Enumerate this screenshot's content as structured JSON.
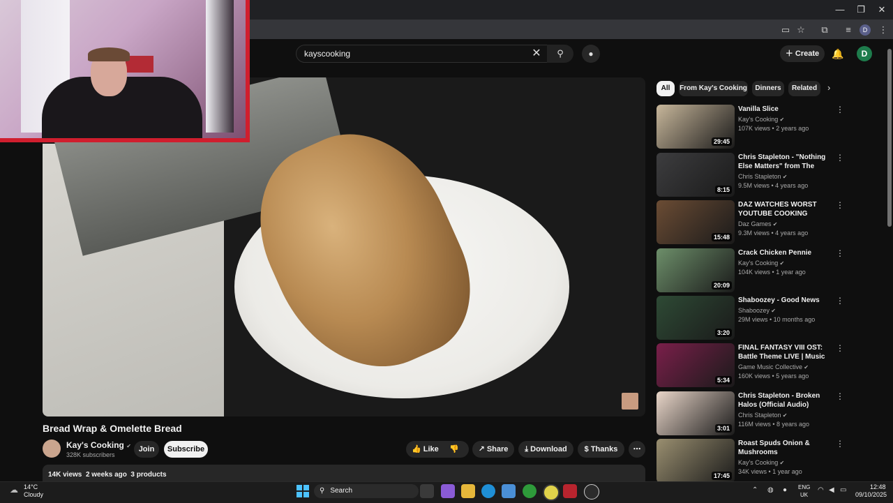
{
  "browser": {
    "profile_initial": "D",
    "window_buttons": {
      "minimize": "—",
      "restore": "❐",
      "close": "✕"
    }
  },
  "header": {
    "search_value": "kayscooking",
    "create_label": "Create",
    "avatar_initial": "D"
  },
  "video": {
    "title": "Bread Wrap & Omelette Bread",
    "channel": "Kay's Cooking",
    "subscribers": "328K subscribers",
    "join_label": "Join",
    "subscribe_label": "Subscribe",
    "like_label": "Like",
    "share_label": "Share",
    "download_label": "Download",
    "thanks_label": "Thanks",
    "views": "14K views",
    "age": "2 weeks ago",
    "products": "3 products"
  },
  "chips": [
    "All",
    "From Kay's Cooking",
    "Dinners",
    "Related"
  ],
  "recommendations": [
    {
      "title": "Vanilla Slice",
      "channel": "Kay's Cooking",
      "views": "107K views",
      "age": "2 years ago",
      "duration": "29:45",
      "color": "#c8b79b"
    },
    {
      "title": "Chris Stapleton - \"Nothing Else Matters\" from The Metallica ...",
      "channel": "Chris Stapleton",
      "views": "9.5M views",
      "age": "4 years ago",
      "duration": "8:15",
      "color": "#3d3d3f"
    },
    {
      "title": "DAZ WATCHES WORST YOUTUBE COOKING",
      "channel": "Daz Games",
      "views": "9.3M views",
      "age": "4 years ago",
      "duration": "15:48",
      "color": "#6b4c34"
    },
    {
      "title": "Crack Chicken Pennie",
      "channel": "Kay's Cooking",
      "views": "104K views",
      "age": "1 year ago",
      "duration": "20:09",
      "color": "#6d8f6a"
    },
    {
      "title": "Shaboozey - Good News",
      "channel": "Shaboozey",
      "views": "29M views",
      "age": "10 months ago",
      "duration": "3:20",
      "color": "#2e4a35"
    },
    {
      "title": "FINAL FANTASY VIII OST: Battle Theme LIVE | Music from ...",
      "channel": "Game Music Collective",
      "views": "160K views",
      "age": "5 years ago",
      "duration": "5:34",
      "color": "#7a1f4a"
    },
    {
      "title": "Chris Stapleton - Broken Halos (Official Audio)",
      "channel": "Chris Stapleton",
      "views": "116M views",
      "age": "8 years ago",
      "duration": "3:01",
      "color": "#e9d6c9"
    },
    {
      "title": "Roast Spuds Onion & Mushrooms",
      "channel": "Kay's Cooking",
      "views": "34K views",
      "age": "1 year ago",
      "duration": "17:45",
      "color": "#9a8f70"
    }
  ],
  "taskbar": {
    "temperature": "14°C",
    "condition": "Cloudy",
    "search_label": "Search",
    "lang": "ENG",
    "region": "UK",
    "time": "12:48",
    "date": "09/10/2025"
  }
}
